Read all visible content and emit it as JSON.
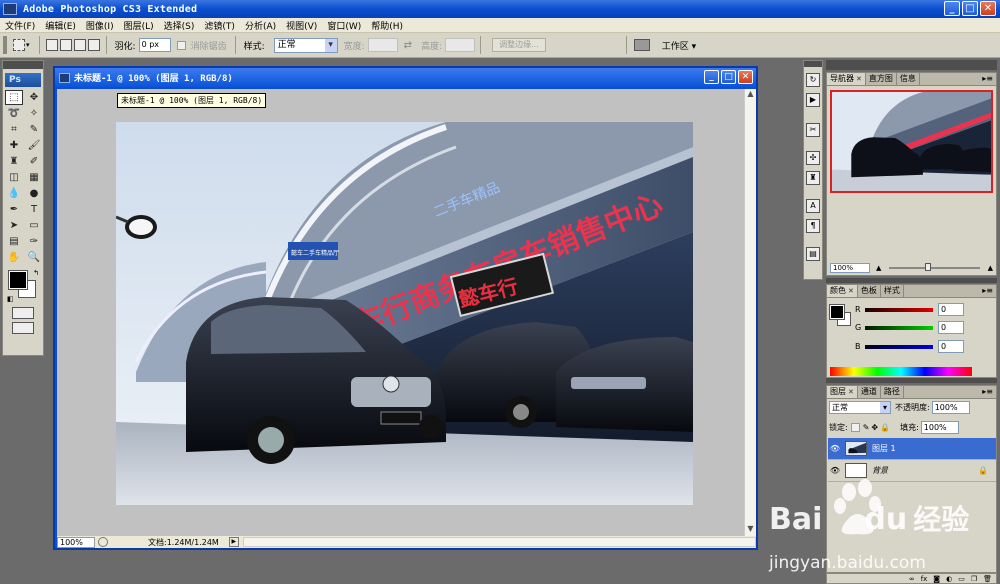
{
  "app": {
    "title": "Adobe Photoshop CS3 Extended",
    "logo_text": "Ps",
    "window_controls": {
      "minimize": "_",
      "maximize": "□",
      "close": "✕"
    }
  },
  "menubar": [
    "文件(F)",
    "编辑(E)",
    "图像(I)",
    "图层(L)",
    "选择(S)",
    "滤镜(T)",
    "分析(A)",
    "视图(V)",
    "窗口(W)",
    "帮助(H)"
  ],
  "options_bar": {
    "feather_label": "羽化:",
    "feather_value": "0 px",
    "antialias_label": "消除锯齿",
    "style_label": "样式:",
    "style_value": "正常",
    "width_label": "宽度:",
    "height_label": "高度:",
    "refine_edge_label": "调整边缘...",
    "workspace_label": "工作区 ▾"
  },
  "document": {
    "title": "未标题-1 @ 100% (图层 1, RGB/8)",
    "tooltip": "未标题-1 @ 100% (图层 1, RGB/8)",
    "zoom": "100%",
    "doc_info": "文档:1.24M/1.24M"
  },
  "photo_signage": {
    "main_sign": "懿车行商务车房车销售中心",
    "top_sign": "二手车精品",
    "red_sign": "懿车行",
    "side_sign": "懿车二手车精品厅"
  },
  "navigator_panel": {
    "tabs": [
      "导航器",
      "直方图",
      "信息"
    ],
    "zoom": "100%"
  },
  "color_panel": {
    "tabs": [
      "颜色",
      "色板",
      "样式"
    ],
    "channels": [
      {
        "name": "R",
        "value": "0",
        "color": "#c00000"
      },
      {
        "name": "G",
        "value": "0",
        "color": "#00a000"
      },
      {
        "name": "B",
        "value": "0",
        "color": "#0000c0"
      }
    ]
  },
  "layers_panel": {
    "tabs": [
      "图层",
      "通道",
      "路径"
    ],
    "blend_mode": "正常",
    "opacity_label": "不透明度:",
    "opacity_value": "100%",
    "lock_label": "锁定:",
    "fill_label": "填充:",
    "fill_value": "100%",
    "layers": [
      {
        "name": "图层 1",
        "selected": true
      },
      {
        "name": "背景",
        "selected": false,
        "locked": true
      }
    ]
  },
  "watermark": {
    "brand": "Bai",
    "brand_suffix": "du",
    "cn": "经验",
    "url": "jingyan.baidu.com"
  }
}
